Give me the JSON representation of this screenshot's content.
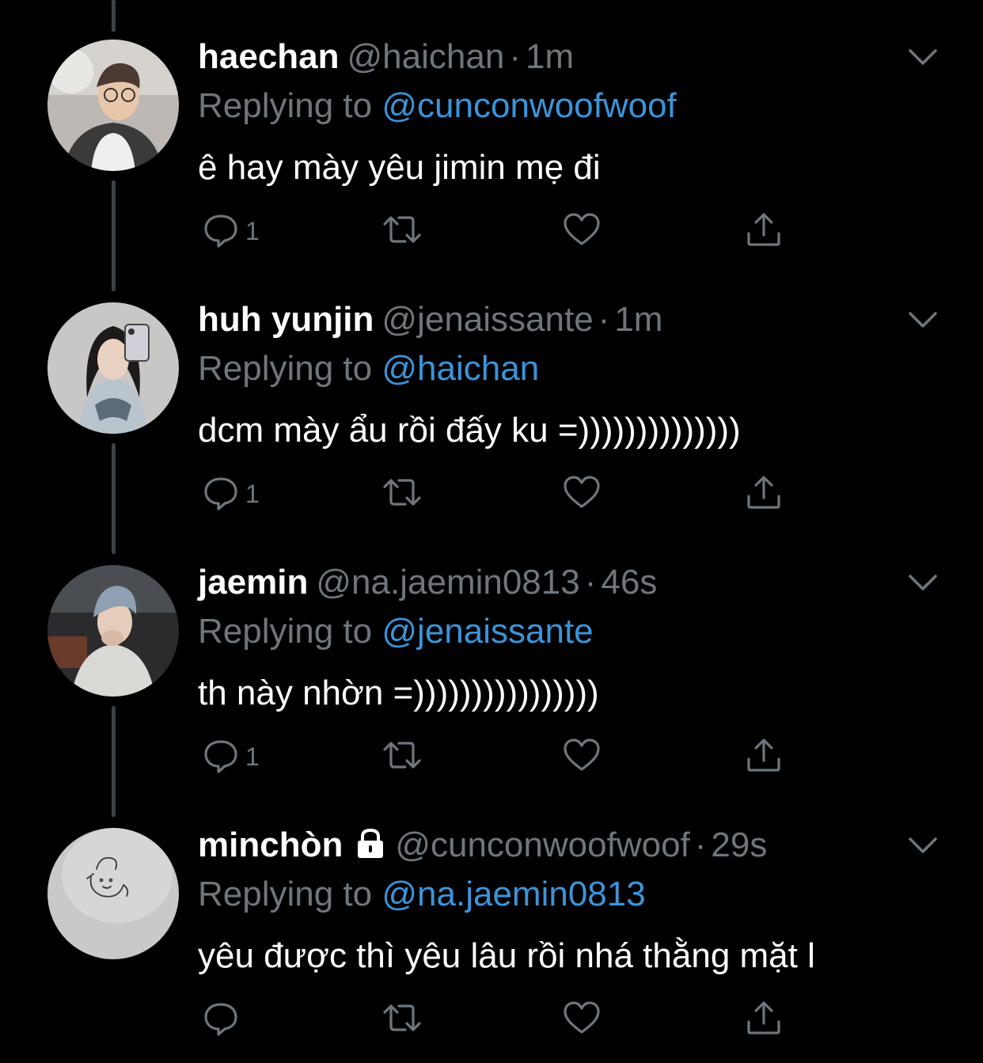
{
  "thread": [
    {
      "name": "haechan",
      "handle": "@haichan",
      "time": "1m",
      "replying_prefix": "Replying to",
      "replying_to": "@cunconwoofwoof",
      "text": "ê hay mày yêu jimin mẹ đi",
      "reply_count": "1",
      "locked": false,
      "avatar": "avatar-photo"
    },
    {
      "name": "huh yunjin",
      "handle": "@jenaissante",
      "time": "1m",
      "replying_prefix": "Replying to",
      "replying_to": "@haichan",
      "text": "dcm mày ẩu rồi đấy ku =))))))))))))))",
      "reply_count": "1",
      "locked": false,
      "avatar": "avatar-photo"
    },
    {
      "name": "jaemin",
      "handle": "@na.jaemin0813",
      "time": "46s",
      "replying_prefix": "Replying to",
      "replying_to": "@jenaissante",
      "text": "th này nhờn =))))))))))))))))",
      "reply_count": "1",
      "locked": false,
      "avatar": "avatar-photo"
    },
    {
      "name": "minchòn",
      "handle": "@cunconwoofwoof",
      "time": "29s",
      "replying_prefix": "Replying to",
      "replying_to": "@na.jaemin0813",
      "text": "yêu được thì yêu lâu rồi nhá thằng mặt l",
      "reply_count": "",
      "locked": true,
      "avatar": "avatar-doodle"
    }
  ],
  "separator": "·",
  "icons": {
    "reply": "reply-icon",
    "retweet": "retweet-icon",
    "like": "heart-icon",
    "share": "share-icon",
    "more": "chevron-down-icon",
    "lock": "lock-icon"
  },
  "colors": {
    "background": "#000000",
    "name": "#ffffff",
    "secondary": "#6e767d",
    "mention": "#3b94d9",
    "thread_line": "#3d4148"
  }
}
